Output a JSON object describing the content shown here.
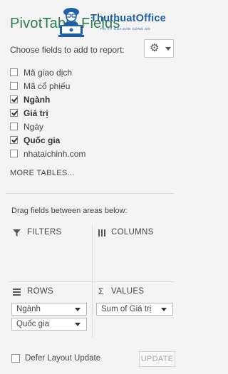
{
  "pane": {
    "title": "PivotTable Fields",
    "choose_label": "Choose fields to add to report:",
    "gear_icon": "gear-icon",
    "fields": [
      {
        "label": "Mã giao dịch",
        "checked": false,
        "bold": false
      },
      {
        "label": "Mã cổ phiếu",
        "checked": false,
        "bold": false
      },
      {
        "label": "Ngành",
        "checked": true,
        "bold": true
      },
      {
        "label": "Giá trị",
        "checked": true,
        "bold": true
      },
      {
        "label": "Ngày",
        "checked": false,
        "bold": false
      },
      {
        "label": "Quốc gia",
        "checked": true,
        "bold": true
      },
      {
        "label": "nhataichinh.com",
        "checked": false,
        "bold": false
      }
    ],
    "more_tables": "MORE TABLES...",
    "drag_label": "Drag fields between areas below:",
    "areas": {
      "filters": {
        "label": "FILTERS",
        "icon": "filter-icon"
      },
      "columns": {
        "label": "COLUMNS",
        "icon": "columns-icon"
      },
      "rows": {
        "label": "ROWS",
        "icon": "rows-icon",
        "items": [
          "Ngành",
          "Quốc gia"
        ]
      },
      "values": {
        "label": "VALUES",
        "icon": "sigma-icon",
        "items": [
          "Sum of Giá trị"
        ]
      }
    },
    "defer_label": "Defer Layout Update",
    "update_label": "UPDATE"
  },
  "watermark": {
    "name": "ThuthuatOffice",
    "tagline": "TRI KỶ CỦA DÂN CÔNG SỞ"
  },
  "colors": {
    "title": "#2e7d4f",
    "logo": "#1e5fa8",
    "background": "#f3f3f3"
  }
}
